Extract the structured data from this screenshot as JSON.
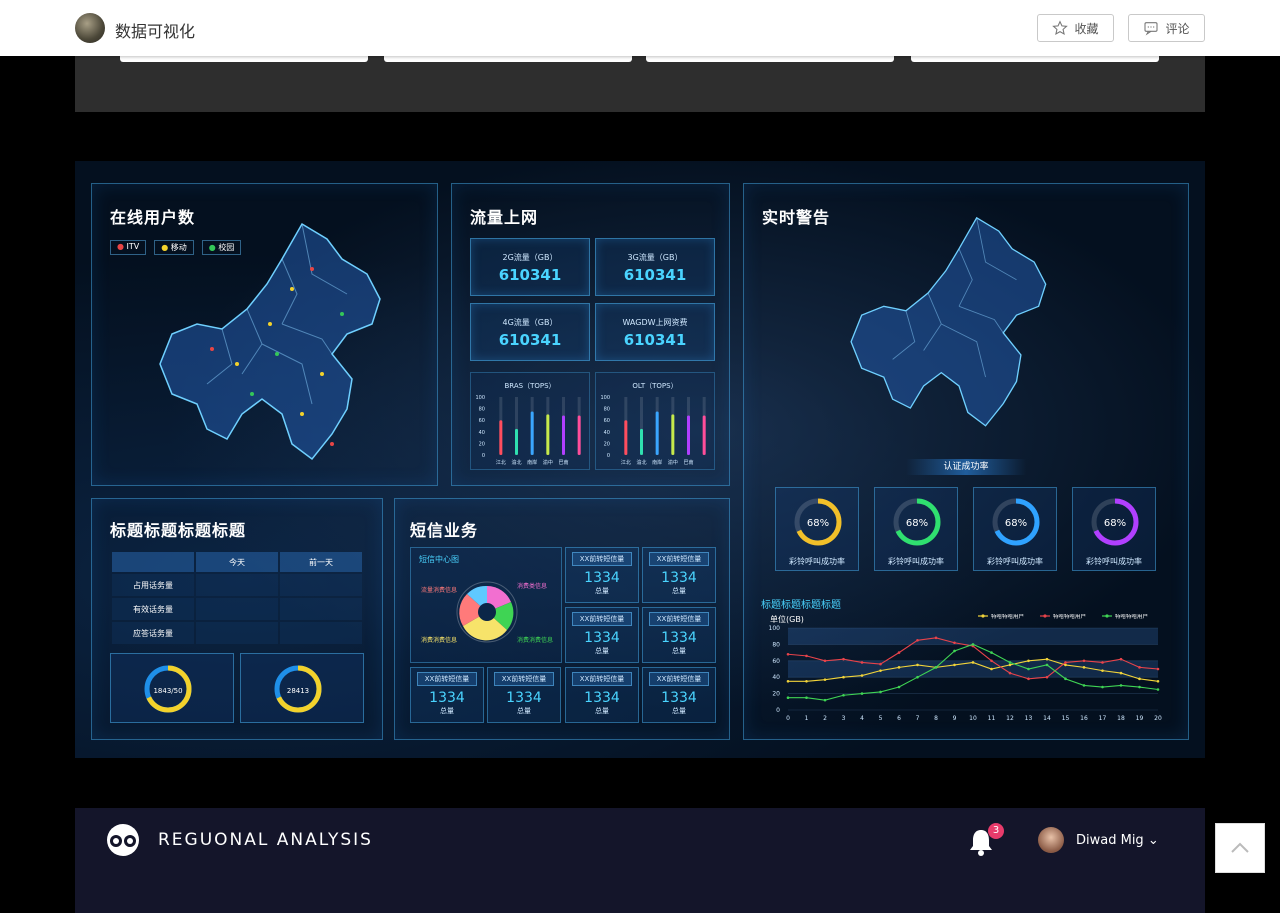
{
  "header": {
    "site_title": "数据可视化",
    "favorite_label": "收藏",
    "comment_label": "评论"
  },
  "dashboard": {
    "online_users": {
      "title": "在线用户数",
      "legend": [
        "ITV",
        "移动",
        "校园"
      ],
      "legend_colors": [
        "#e84545",
        "#f3d22b",
        "#34c759"
      ]
    },
    "traffic": {
      "title": "流量上网",
      "stats": [
        {
          "label": "2G流量（GB）",
          "value": "610341"
        },
        {
          "label": "3G流量（GB）",
          "value": "610341"
        },
        {
          "label": "4G流量（GB）",
          "value": "610341"
        },
        {
          "label": "WAGDW上网资费",
          "value": "610341"
        }
      ],
      "bras_title": "BRAS（TOPS）",
      "olt_title": "OLT（TOPS）",
      "bar_yticks": [
        "100",
        "80",
        "60",
        "40",
        "20",
        "0"
      ],
      "bar_categories": [
        "江北",
        "渝北",
        "南岸",
        "渝中",
        "巴南"
      ]
    },
    "alerts": {
      "title": "实时警告"
    },
    "table_panel": {
      "title": "标题标题标题标题",
      "columns": [
        "",
        "今天",
        "前一天"
      ],
      "rows": [
        "占用话务量",
        "有效话务量",
        "应答话务量"
      ],
      "donuts": [
        {
          "center": "1843/50"
        },
        {
          "center": "28413"
        }
      ]
    },
    "sms": {
      "title": "短信业务",
      "center_title": "短信中心图",
      "pie_labels": [
        "流量消费信息",
        "消费类信息",
        "消费消费信息",
        "消费消费信息"
      ],
      "cards": [
        {
          "title": "XX前转短信量",
          "value": "1334",
          "unit": "总量"
        },
        {
          "title": "XX前转短信量",
          "value": "1334",
          "unit": "总量"
        },
        {
          "title": "XX前转短信量",
          "value": "1334",
          "unit": "总量"
        },
        {
          "title": "XX前转短信量",
          "value": "1334",
          "unit": "总量"
        },
        {
          "title": "XX前转短信量",
          "value": "1334",
          "unit": "总量"
        },
        {
          "title": "XX前转短信量",
          "value": "1334",
          "unit": "总量"
        },
        {
          "title": "XX前转短信量",
          "value": "1334",
          "unit": "总量"
        },
        {
          "title": "XX前转短信量",
          "value": "1334",
          "unit": "总量"
        }
      ]
    },
    "auth": {
      "title": "认证成功率",
      "rates": [
        {
          "value": "68%",
          "label": "彩铃呼叫成功率",
          "color": "#f2c029"
        },
        {
          "value": "68%",
          "label": "彩铃呼叫成功率",
          "color": "#2fe06f"
        },
        {
          "value": "68%",
          "label": "彩铃呼叫成功率",
          "color": "#2fa2ff"
        },
        {
          "value": "68%",
          "label": "彩铃呼叫成功率",
          "color": "#b13fff"
        }
      ]
    },
    "line_panel": {
      "title": "标题标题标题标题",
      "unit": "单位(GB)"
    }
  },
  "chart_data": [
    {
      "type": "bar",
      "title": "BRAS（TOPS）",
      "categories": [
        "江北",
        "渝北",
        "南岸",
        "渝中",
        "巴南"
      ],
      "values": [
        60,
        45,
        75,
        70,
        68,
        68
      ],
      "ylim": [
        0,
        100
      ],
      "ylabel": "",
      "xlabel": ""
    },
    {
      "type": "bar",
      "title": "OLT（TOPS）",
      "categories": [
        "江北",
        "渝北",
        "南岸",
        "渝中",
        "巴南"
      ],
      "values": [
        60,
        45,
        75,
        70,
        68,
        68
      ],
      "ylim": [
        0,
        100
      ],
      "ylabel": "",
      "xlabel": ""
    },
    {
      "type": "line",
      "title": "",
      "ylabel": "单位(GB)",
      "xlabel": "",
      "x": [
        0,
        1,
        2,
        3,
        4,
        5,
        6,
        7,
        8,
        9,
        10,
        11,
        12,
        13,
        14,
        15,
        16,
        17,
        18,
        19,
        20
      ],
      "yticks": [
        0,
        20,
        40,
        60,
        80,
        100
      ],
      "ylim": [
        0,
        100
      ],
      "series": [
        {
          "name": "特哈特哈用户",
          "color": "#f2d43a",
          "values": [
            35,
            35,
            37,
            40,
            42,
            48,
            52,
            55,
            52,
            55,
            58,
            50,
            55,
            60,
            62,
            55,
            52,
            48,
            45,
            38,
            35
          ]
        },
        {
          "name": "特哈特哈用户",
          "color": "#e8434a",
          "values": [
            68,
            66,
            60,
            62,
            58,
            56,
            70,
            85,
            88,
            82,
            78,
            60,
            45,
            38,
            40,
            58,
            60,
            58,
            62,
            52,
            50
          ]
        },
        {
          "name": "特哈特哈用户",
          "color": "#3fd454",
          "values": [
            15,
            15,
            12,
            18,
            20,
            22,
            28,
            40,
            52,
            72,
            80,
            70,
            58,
            50,
            55,
            38,
            30,
            28,
            30,
            28,
            25
          ]
        }
      ]
    }
  ],
  "bottom_app": {
    "title": "REGUONAL ANALYSIS",
    "notification_count": "3",
    "user_name": "Diwad Mig"
  }
}
